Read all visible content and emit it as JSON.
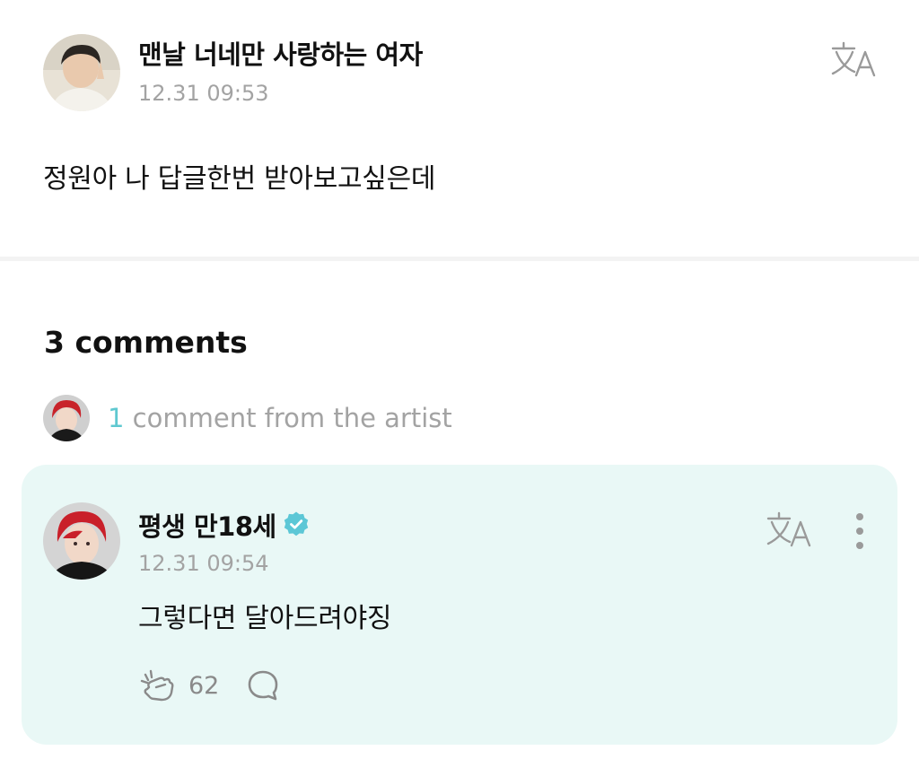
{
  "post": {
    "author": "맨날 너네만 사랑하는 여자",
    "timestamp": "12.31 09:53",
    "body": "정원아 나 답글한번 받아보고싶은데",
    "icons": {
      "avatar": "user-avatar",
      "translate": "translate-icon"
    }
  },
  "comments": {
    "count_label": "3 comments",
    "artist_summary": {
      "count": "1",
      "label": " comment from the artist"
    },
    "items": [
      {
        "author": "평생 만18세",
        "verified": true,
        "timestamp": "12.31 09:54",
        "body": "그렇다면 달아드려야징",
        "likes": "62",
        "icons": {
          "like": "like-hand-icon",
          "reply": "reply-bubble-icon",
          "more": "more-vertical-icon",
          "translate": "translate-icon"
        }
      }
    ]
  },
  "colors": {
    "accent": "#5fc8d0",
    "card_bg": "#e9f8f6",
    "muted_text": "#a3a3a3",
    "verified": "#5cc7d6"
  }
}
